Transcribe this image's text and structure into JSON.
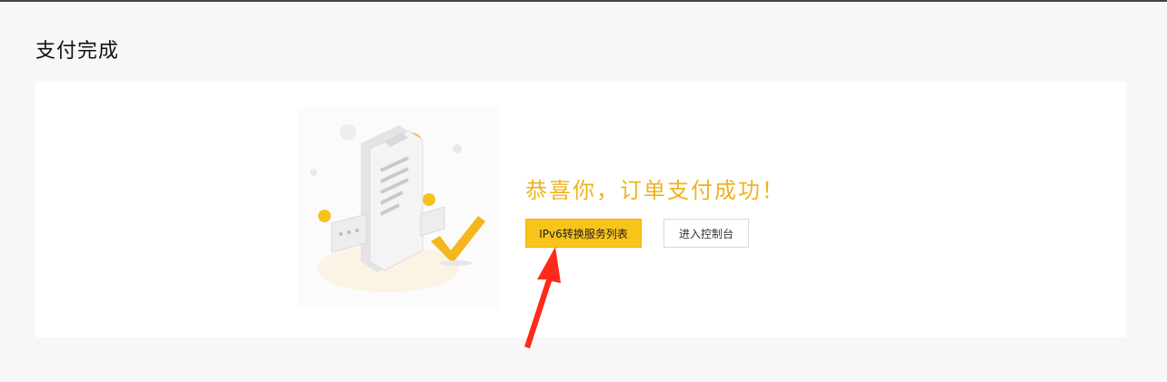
{
  "page": {
    "title": "支付完成"
  },
  "result": {
    "message": "恭喜你，订单支付成功！",
    "primary_button": "IPv6转换服务列表",
    "secondary_button": "进入控制台"
  },
  "icons": {
    "illustration": "payment-success-illustration-icon",
    "check": "check-mark-icon",
    "annotation": "red-arrow-icon"
  },
  "colors": {
    "accent": "#f8c41a",
    "success_text": "#f0b21d",
    "annotation_arrow": "#ff2a1a"
  }
}
